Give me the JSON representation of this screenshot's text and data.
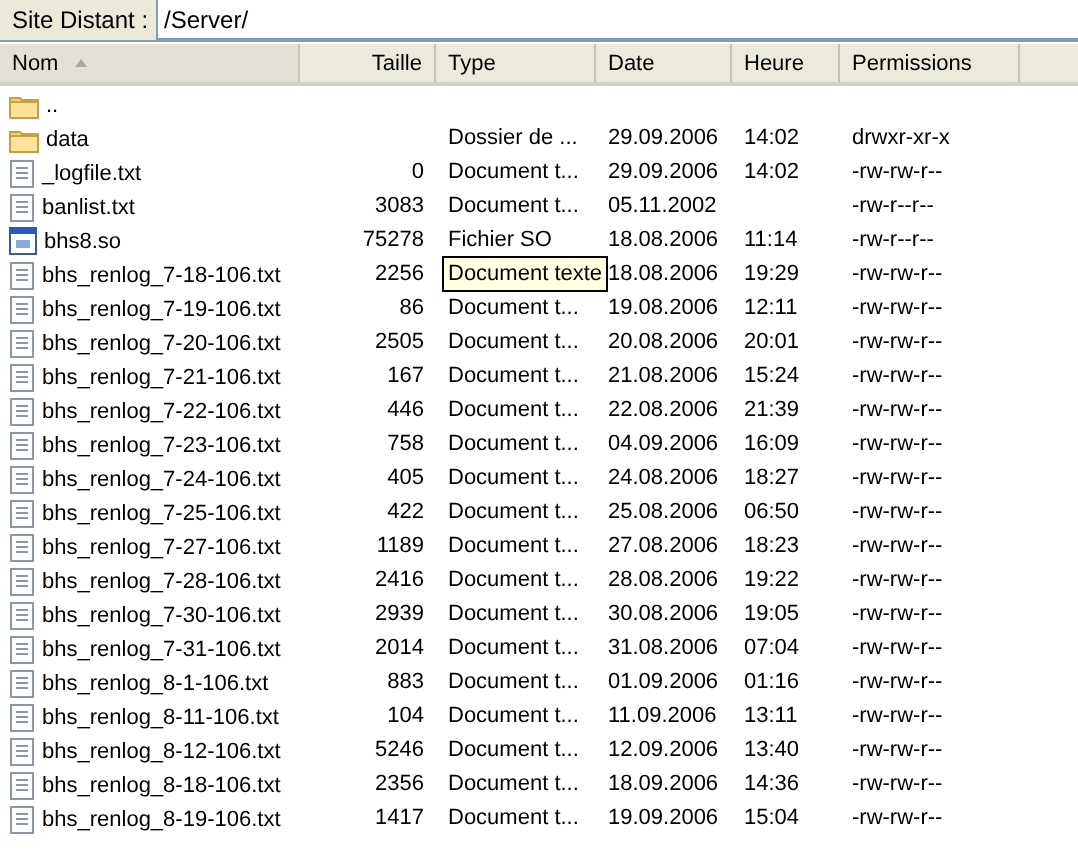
{
  "address": {
    "label": "Site Distant :",
    "value": "/Server/"
  },
  "columns": [
    {
      "label": "Nom",
      "sorted": true
    },
    {
      "label": "Taille",
      "sorted": false
    },
    {
      "label": "Type",
      "sorted": false
    },
    {
      "label": "Date",
      "sorted": false
    },
    {
      "label": "Heure",
      "sorted": false
    },
    {
      "label": "Permissions",
      "sorted": false
    }
  ],
  "rows": [
    {
      "kind": "folder",
      "name": ".."
    },
    {
      "kind": "folder",
      "name": "data",
      "type": "Dossier de ...",
      "date": "29.09.2006",
      "time": "14:02",
      "permissions": "drwxr-xr-x"
    },
    {
      "kind": "text",
      "name": "_logfile.txt",
      "size": "0",
      "type": "Document t...",
      "date": "29.09.2006",
      "time": "14:02",
      "permissions": "-rw-rw-r--"
    },
    {
      "kind": "text",
      "name": "banlist.txt",
      "size": "3083",
      "type": "Document t...",
      "date": "05.11.2002",
      "permissions": "-rw-r--r--"
    },
    {
      "kind": "app",
      "name": "bhs8.so",
      "size": "75278",
      "type": "Fichier SO",
      "date": "18.08.2006",
      "time": "11:14",
      "permissions": "-rw-r--r--"
    },
    {
      "kind": "text",
      "name": "bhs_renlog_7-18-106.txt",
      "size": "2256",
      "tooltip": "Document texte",
      "date": "18.08.2006",
      "time": "19:29",
      "permissions": "-rw-rw-r--"
    },
    {
      "kind": "text",
      "name": "bhs_renlog_7-19-106.txt",
      "size": "86",
      "type": "Document t...",
      "date": "19.08.2006",
      "time": "12:11",
      "permissions": "-rw-rw-r--"
    },
    {
      "kind": "text",
      "name": "bhs_renlog_7-20-106.txt",
      "size": "2505",
      "type": "Document t...",
      "date": "20.08.2006",
      "time": "20:01",
      "permissions": "-rw-rw-r--"
    },
    {
      "kind": "text",
      "name": "bhs_renlog_7-21-106.txt",
      "size": "167",
      "type": "Document t...",
      "date": "21.08.2006",
      "time": "15:24",
      "permissions": "-rw-rw-r--"
    },
    {
      "kind": "text",
      "name": "bhs_renlog_7-22-106.txt",
      "size": "446",
      "type": "Document t...",
      "date": "22.08.2006",
      "time": "21:39",
      "permissions": "-rw-rw-r--"
    },
    {
      "kind": "text",
      "name": "bhs_renlog_7-23-106.txt",
      "size": "758",
      "type": "Document t...",
      "date": "04.09.2006",
      "time": "16:09",
      "permissions": "-rw-rw-r--"
    },
    {
      "kind": "text",
      "name": "bhs_renlog_7-24-106.txt",
      "size": "405",
      "type": "Document t...",
      "date": "24.08.2006",
      "time": "18:27",
      "permissions": "-rw-rw-r--"
    },
    {
      "kind": "text",
      "name": "bhs_renlog_7-25-106.txt",
      "size": "422",
      "type": "Document t...",
      "date": "25.08.2006",
      "time": "06:50",
      "permissions": "-rw-rw-r--"
    },
    {
      "kind": "text",
      "name": "bhs_renlog_7-27-106.txt",
      "size": "1189",
      "type": "Document t...",
      "date": "27.08.2006",
      "time": "18:23",
      "permissions": "-rw-rw-r--"
    },
    {
      "kind": "text",
      "name": "bhs_renlog_7-28-106.txt",
      "size": "2416",
      "type": "Document t...",
      "date": "28.08.2006",
      "time": "19:22",
      "permissions": "-rw-rw-r--"
    },
    {
      "kind": "text",
      "name": "bhs_renlog_7-30-106.txt",
      "size": "2939",
      "type": "Document t...",
      "date": "30.08.2006",
      "time": "19:05",
      "permissions": "-rw-rw-r--"
    },
    {
      "kind": "text",
      "name": "bhs_renlog_7-31-106.txt",
      "size": "2014",
      "type": "Document t...",
      "date": "31.08.2006",
      "time": "07:04",
      "permissions": "-rw-rw-r--"
    },
    {
      "kind": "text",
      "name": "bhs_renlog_8-1-106.txt",
      "size": "883",
      "type": "Document t...",
      "date": "01.09.2006",
      "time": "01:16",
      "permissions": "-rw-rw-r--"
    },
    {
      "kind": "text",
      "name": "bhs_renlog_8-11-106.txt",
      "size": "104",
      "type": "Document t...",
      "date": "11.09.2006",
      "time": "13:11",
      "permissions": "-rw-rw-r--"
    },
    {
      "kind": "text",
      "name": "bhs_renlog_8-12-106.txt",
      "size": "5246",
      "type": "Document t...",
      "date": "12.09.2006",
      "time": "13:40",
      "permissions": "-rw-rw-r--"
    },
    {
      "kind": "text",
      "name": "bhs_renlog_8-18-106.txt",
      "size": "2356",
      "type": "Document t...",
      "date": "18.09.2006",
      "time": "14:36",
      "permissions": "-rw-rw-r--"
    },
    {
      "kind": "text",
      "name": "bhs_renlog_8-19-106.txt",
      "size": "1417",
      "type": "Document t...",
      "date": "19.09.2006",
      "time": "15:04",
      "permissions": "-rw-rw-r--"
    }
  ]
}
